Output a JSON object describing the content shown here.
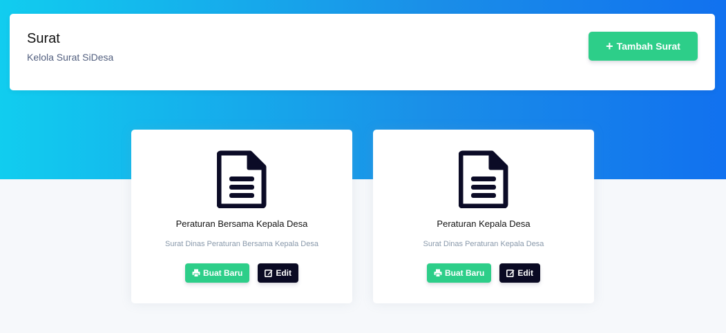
{
  "header": {
    "title": "Surat",
    "subtitle": "Kelola Surat SiDesa",
    "add_button": {
      "icon": "plus-icon",
      "label": "Tambah Surat"
    }
  },
  "colors": {
    "gradient_start": "#11cdef",
    "gradient_end": "#1171ef",
    "success": "#2dce89",
    "dark": "#0a0a23",
    "icon": "#0b0b26"
  },
  "cards": [
    {
      "icon": "document-icon",
      "title": "Peraturan Bersama Kepala Desa",
      "description": "Surat Dinas Peraturan Bersama Kepala Desa",
      "new_button": {
        "icon": "print-icon",
        "label": "Buat Baru"
      },
      "edit_button": {
        "icon": "edit-icon",
        "label": "Edit"
      }
    },
    {
      "icon": "document-icon",
      "title": "Peraturan Kepala Desa",
      "description": "Surat Dinas Peraturan Kepala Desa",
      "new_button": {
        "icon": "print-icon",
        "label": "Buat Baru"
      },
      "edit_button": {
        "icon": "edit-icon",
        "label": "Edit"
      }
    }
  ]
}
